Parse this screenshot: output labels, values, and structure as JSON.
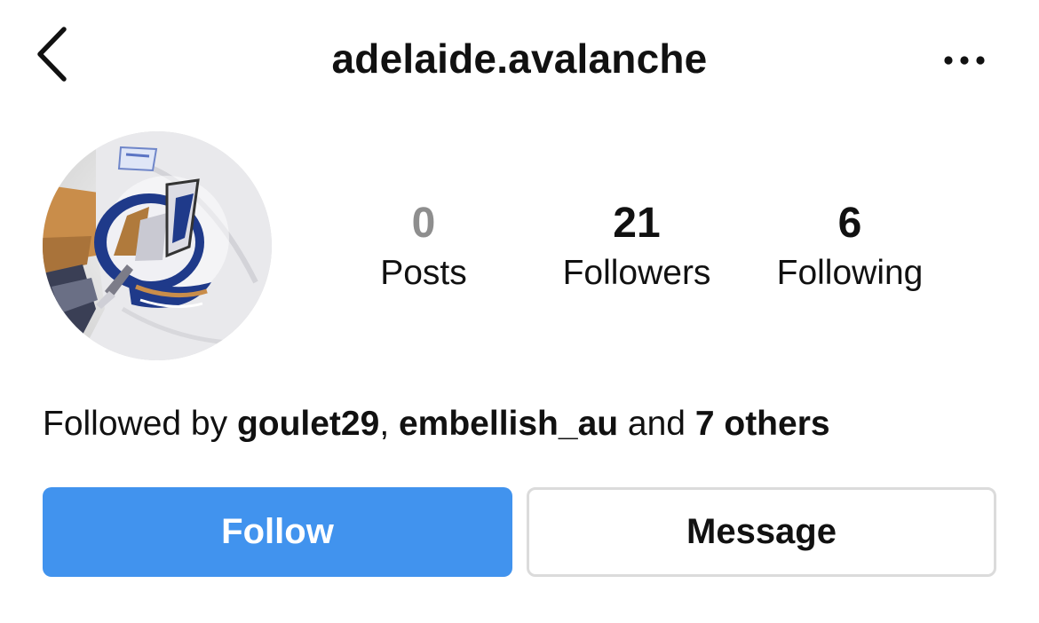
{
  "header": {
    "username": "adelaide.avalanche",
    "back_icon": "chevron-left-icon",
    "more_icon": "more-horizontal-icon"
  },
  "profile": {
    "avatar": "hockey-jersey-logo-avatar",
    "stats": {
      "posts": {
        "value": "0",
        "label": "Posts"
      },
      "followers": {
        "value": "21",
        "label": "Followers"
      },
      "following": {
        "value": "6",
        "label": "Following"
      }
    },
    "followed_by": {
      "prefix": "Followed by ",
      "user1": "goulet29",
      "separator": ", ",
      "user2": "embellish_au",
      "conjunction": " and ",
      "others": "7 others"
    }
  },
  "actions": {
    "follow_label": "Follow",
    "message_label": "Message"
  },
  "colors": {
    "follow_button_bg": "#4193ee",
    "posts_count": "#8e8e8e",
    "message_border": "#dbdbdb"
  }
}
